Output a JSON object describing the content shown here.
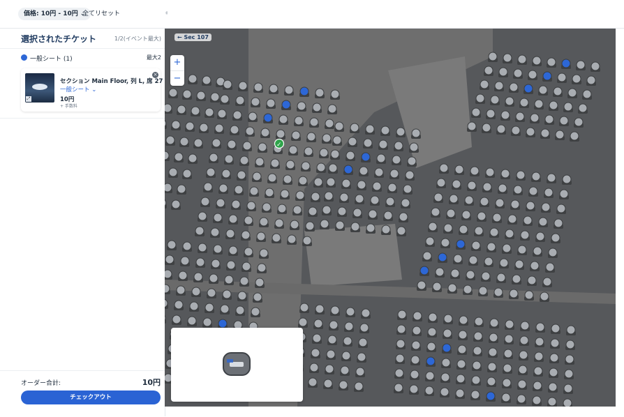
{
  "topbar": {
    "price_filter": "価格: 10円 - 10円",
    "reset_label": "全てリセット",
    "separator": "ᅦ"
  },
  "sidebar": {
    "title": "選択されたチケット",
    "count": "1/2(イベント最大)",
    "category": {
      "label": "一般シート (1)",
      "max": "最大2",
      "color": "#2d67d6"
    },
    "ticket": {
      "section": "セクション Main Floor, 列 L, 席 27",
      "category": "一般シート",
      "price": "10円",
      "fee": "+ 手数料"
    },
    "footer": {
      "total_label": "オーダー合計:",
      "total_value": "10円",
      "checkout_label": "チェックアウト"
    }
  },
  "map": {
    "back_label": "← Sec 107",
    "zoom_in": "+",
    "zoom_out": "−",
    "available_color": "#2d67d6",
    "selected_color": "#2fa44a",
    "seat_color": "#a9adb2",
    "floor_color": "#6e6e6e"
  },
  "icons": {
    "chevron": "chevron-down-icon",
    "close": "close-circle-icon",
    "check": "check-icon",
    "accessible": "accessible-seat-icon"
  }
}
